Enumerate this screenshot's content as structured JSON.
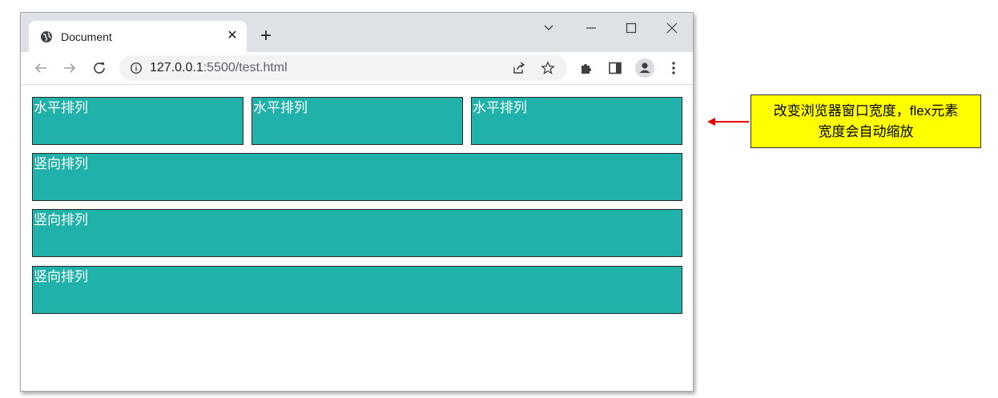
{
  "browser": {
    "tab": {
      "title": "Document",
      "favicon": "globe-icon",
      "close_icon": "close-icon"
    },
    "new_tab_icon": "plus-icon",
    "window_controls": [
      "chevron-down-icon",
      "minimize-icon",
      "maximize-icon",
      "close-icon"
    ],
    "toolbar": {
      "back_icon": "arrow-left-icon",
      "forward_icon": "arrow-right-icon",
      "reload_icon": "reload-icon",
      "url_host": "127.0.0.1",
      "url_rest": ":5500/test.html",
      "info_icon": "info-icon",
      "share_icon": "share-icon",
      "bookmark_icon": "star-icon",
      "extensions_icon": "puzzle-icon",
      "sidepanel_icon": "side-panel-icon",
      "profile_icon": "profile-icon",
      "menu_icon": "kebab-menu-icon"
    }
  },
  "page": {
    "row_boxes": [
      "水平排列",
      "水平排列",
      "水平排列"
    ],
    "column_boxes": [
      "竖向排列",
      "竖向排列",
      "竖向排列"
    ],
    "colors": {
      "box_bg": "#20b2aa",
      "box_border": "#2b2b2b",
      "text": "#ffffff"
    }
  },
  "annotation": {
    "line1": "改变浏览器窗口宽度，flex元素",
    "line2": "宽度会自动缩放",
    "colors": {
      "bg": "#ffff00",
      "arrow": "#e00000"
    }
  }
}
